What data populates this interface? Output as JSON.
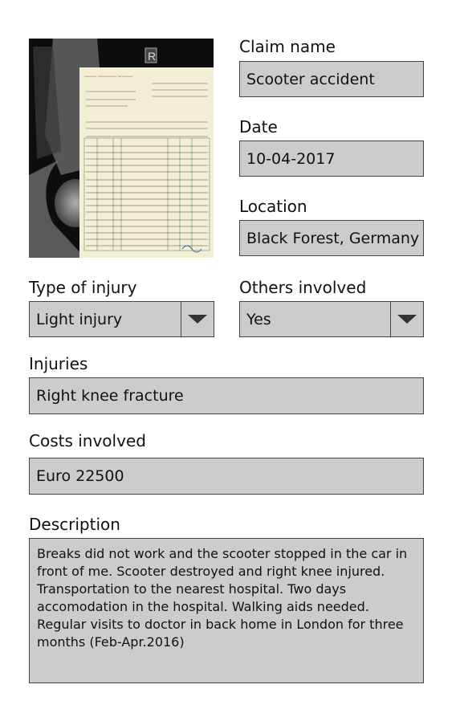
{
  "claim": {
    "name_label": "Claim name",
    "name_value": "Scooter accident",
    "date_label": "Date",
    "date_value": "10-04-2017",
    "location_label": "Location",
    "location_value": "Black Forest, Germany",
    "injury_type_label": "Type of injury",
    "injury_type_value": "Light injury",
    "others_label": "Others involved",
    "others_value": "Yes",
    "injuries_label": "Injuries",
    "injuries_value": "Right knee fracture",
    "costs_label": "Costs involved",
    "costs_value": "Euro 22500",
    "description_label": "Description",
    "description_value": "Breaks did not work and the scooter stopped in the car in front of me. Scooter destroyed and right knee injured. Transportation to the nearest hospital. Two days accomodation in the hospital. Walking aids needed. Regular visits to doctor in back home in London for three months (Feb-Apr.2016)"
  },
  "photo": {
    "xray_marker": "R"
  },
  "icons": {
    "dropdown": "triangle-down-icon"
  }
}
